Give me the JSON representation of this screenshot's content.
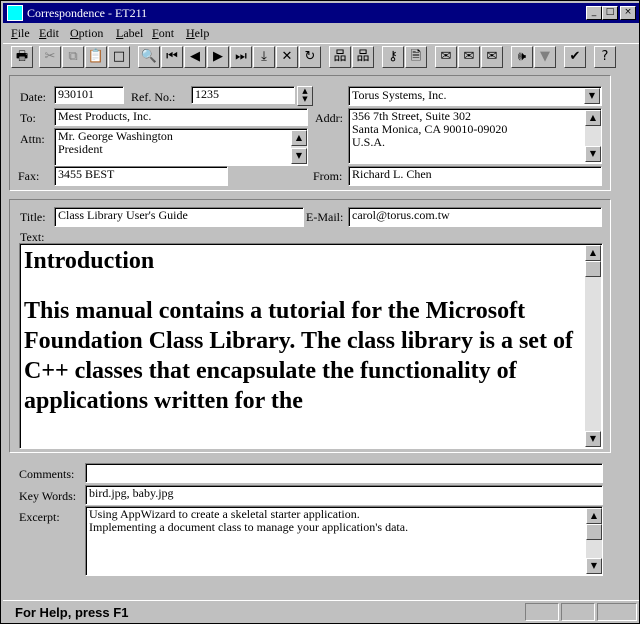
{
  "window": {
    "title": "Correspondence - ET211",
    "controls": {
      "minimize": "_",
      "maximize": "□",
      "close": "×"
    }
  },
  "menu": [
    {
      "label": "File",
      "key": "F",
      "rest": "ile"
    },
    {
      "label": "Edit",
      "key": "E",
      "rest": "dit"
    },
    {
      "label": "Option",
      "key": "O",
      "rest": "ption"
    },
    {
      "label": "Label",
      "key": "L",
      "rest": "abel"
    },
    {
      "label": "Font",
      "key": "F",
      "rest": "ont"
    },
    {
      "label": "Help",
      "key": "H",
      "rest": "elp"
    }
  ],
  "toolbar": [
    {
      "icon": "printer-icon",
      "glyph": "🖶",
      "enabled": true
    },
    {
      "icon": "cut-icon",
      "glyph": "✂",
      "enabled": false
    },
    {
      "icon": "copy-icon",
      "glyph": "⧉",
      "enabled": false
    },
    {
      "icon": "paste-icon",
      "glyph": "📋",
      "enabled": true
    },
    {
      "icon": "new-blank-icon",
      "glyph": "□",
      "enabled": true
    },
    {
      "icon": "search-icon",
      "glyph": "🔍",
      "enabled": true
    },
    {
      "icon": "first-record-icon",
      "glyph": "⏮",
      "enabled": true
    },
    {
      "icon": "previous-record-icon",
      "glyph": "◀",
      "enabled": true
    },
    {
      "icon": "next-record-icon",
      "glyph": "▶",
      "enabled": true
    },
    {
      "icon": "last-record-icon",
      "glyph": "⏭",
      "enabled": true
    },
    {
      "icon": "import-icon",
      "glyph": "⤓",
      "enabled": true
    },
    {
      "icon": "delete-icon",
      "glyph": "✕",
      "enabled": true
    },
    {
      "icon": "refresh-icon",
      "glyph": "↻",
      "enabled": true
    },
    {
      "icon": "network-icon",
      "glyph": "品",
      "enabled": true
    },
    {
      "icon": "network-alt-icon",
      "glyph": "品",
      "enabled": true
    },
    {
      "icon": "key-icon",
      "glyph": "⚷",
      "enabled": true
    },
    {
      "icon": "preview-icon",
      "glyph": "🗎",
      "enabled": true
    },
    {
      "icon": "mail-open-icon",
      "glyph": "✉",
      "enabled": true
    },
    {
      "icon": "mail-icon",
      "glyph": "✉",
      "enabled": true
    },
    {
      "icon": "mail-send-icon",
      "glyph": "✉",
      "enabled": true
    },
    {
      "icon": "speaker-icon",
      "glyph": "🕪",
      "enabled": true
    },
    {
      "icon": "dropdown-arrow-icon",
      "glyph": "▼",
      "enabled": false
    },
    {
      "icon": "spellcheck-icon",
      "glyph": "✔",
      "enabled": true
    },
    {
      "icon": "help-icon",
      "glyph": "?",
      "enabled": true
    }
  ],
  "header_form": {
    "date_label": "Date:",
    "date_value": "930101",
    "ref_label": "Ref. No.:",
    "ref_value": "1235",
    "company_value": "Torus Systems, Inc.",
    "to_label": "To:",
    "to_value": "Mest Products, Inc.",
    "addr_label": "Addr:",
    "addr_value": "356 7th Street, Suite 302\nSanta Monica, CA 90010-09020\nU.S.A.",
    "attn_label": "Attn:",
    "attn_value": "Mr. George Washington\nPresident",
    "fax_label": "Fax:",
    "fax_value": "3455 BEST",
    "from_label": "From:",
    "from_value": "Richard L. Chen"
  },
  "body_form": {
    "title_label": "Title:",
    "title_value": "Class Library User's Guide",
    "email_label": "E-Mail:",
    "email_value": "carol@torus.com.tw",
    "text_label": "Text:",
    "text_heading": "Introduction",
    "text_body": "This manual contains a tutorial for the Microsoft Foundation Class Library. The class library is a set of C++ classes that encapsulate the functionality of applications written for the"
  },
  "footer_form": {
    "comments_label": "Comments:",
    "comments_value": "",
    "keywords_label": "Key Words:",
    "keywords_value": "bird.jpg, baby.jpg",
    "excerpt_label": "Excerpt:",
    "excerpt_value": "Using AppWizard to create a skeletal starter application.\nImplementing a document class to manage your application's data."
  },
  "status": {
    "text": "For Help, press F1"
  }
}
